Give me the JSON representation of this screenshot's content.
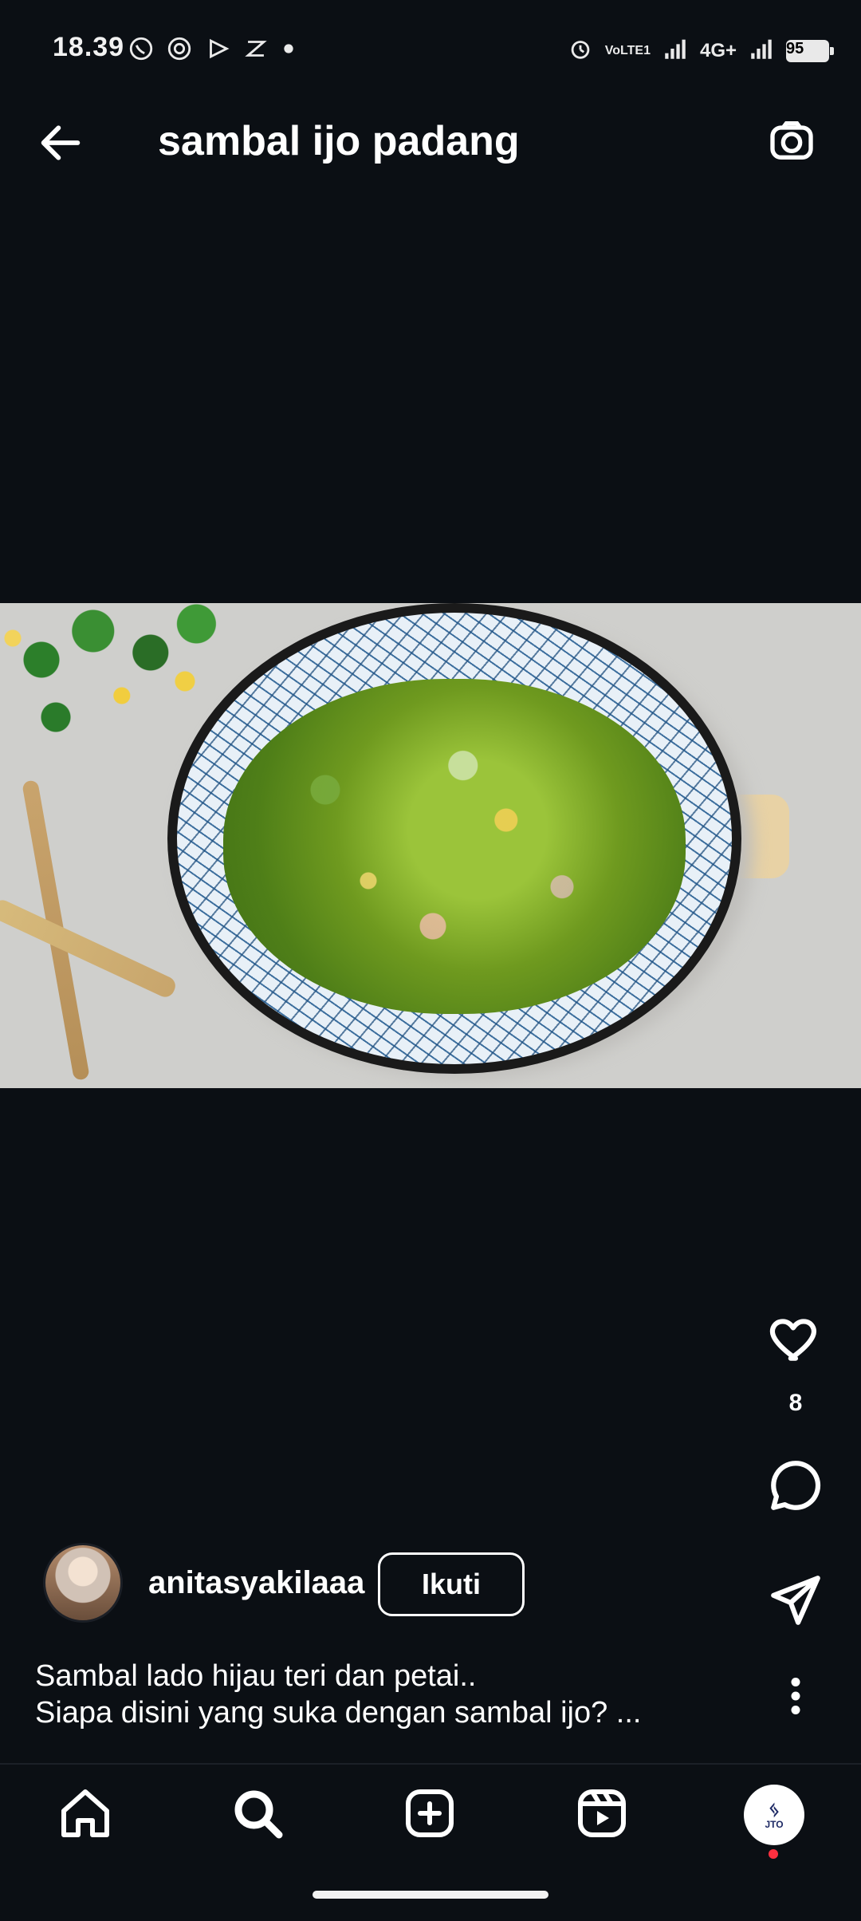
{
  "status_bar": {
    "time": "18.39",
    "left_icons": [
      "whatsapp-icon",
      "target-icon",
      "play-icon",
      "capcut-icon",
      "dot-icon"
    ],
    "right_icons": [
      "alarm-icon",
      "volte-icon",
      "signal-icon",
      "4g-icon",
      "signal-icon"
    ],
    "network_label": "4G+",
    "volte_label": "VoLTE1",
    "battery_percent": "95"
  },
  "header": {
    "title": "sambal ijo padang",
    "back_icon": "arrow-left-icon",
    "camera_icon": "camera-icon"
  },
  "post": {
    "like_count": "8",
    "author": {
      "username": "anitasyakilaaa",
      "follow_label": "Ikuti"
    },
    "caption_line1": "Sambal lado hijau teri dan petai..",
    "caption_line2": "Siapa disini yang suka dengan sambal ijo? ..."
  },
  "bottom_nav": {
    "items": [
      "home-icon",
      "search-icon",
      "create-icon",
      "reels-icon",
      "profile-avatar"
    ],
    "profile_badge_text": "JTO"
  },
  "colors": {
    "background": "#0b0f14",
    "text": "#ffffff",
    "accent_badge": "#ff3040"
  }
}
